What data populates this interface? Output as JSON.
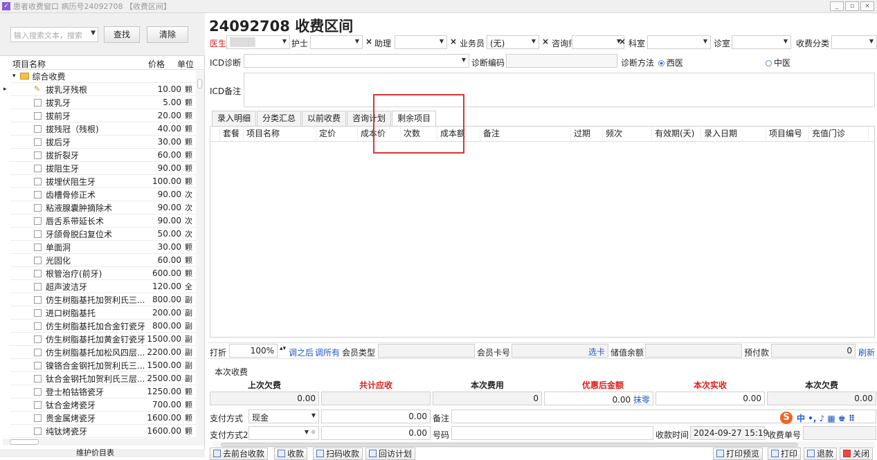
{
  "window": {
    "title": "患者收费窗口 病历号24092708 【收费区间】",
    "buttons": [
      "_",
      "▫",
      "×"
    ]
  },
  "left": {
    "search_placeholder": "输入搜索文本，搜索",
    "find_label": "查找",
    "clear_label": "清除",
    "columns": [
      "项目名称",
      "价格",
      "单位"
    ],
    "group": "综合收费",
    "items": [
      {
        "name": "拔乳牙残根",
        "price": "10.00",
        "unit": "颗"
      },
      {
        "name": "拔乳牙",
        "price": "5.00",
        "unit": "颗"
      },
      {
        "name": "拔前牙",
        "price": "20.00",
        "unit": "颗"
      },
      {
        "name": "拔残冠（残根)",
        "price": "40.00",
        "unit": "颗"
      },
      {
        "name": "拔后牙",
        "price": "30.00",
        "unit": "颗"
      },
      {
        "name": "拔折裂牙",
        "price": "60.00",
        "unit": "颗"
      },
      {
        "name": "拔阻生牙",
        "price": "90.00",
        "unit": "颗"
      },
      {
        "name": "拔埋伏阻生牙",
        "price": "100.00",
        "unit": "颗"
      },
      {
        "name": "齿槽骨修正术",
        "price": "90.00",
        "unit": "次"
      },
      {
        "name": "粘液腺囊肿摘除术",
        "price": "90.00",
        "unit": "次"
      },
      {
        "name": "唇舌系带延长术",
        "price": "90.00",
        "unit": "次"
      },
      {
        "name": "牙颌骨脱臼复位术",
        "price": "50.00",
        "unit": "次"
      },
      {
        "name": "单面洞",
        "price": "30.00",
        "unit": "颗"
      },
      {
        "name": "光固化",
        "price": "60.00",
        "unit": "颗"
      },
      {
        "name": "根管治疗(前牙)",
        "price": "600.00",
        "unit": "颗"
      },
      {
        "name": "超声波洁牙",
        "price": "120.00",
        "unit": "全"
      },
      {
        "name": "仿生树脂基托加贺利氏三...",
        "price": "800.00",
        "unit": "副"
      },
      {
        "name": "进口树脂基托",
        "price": "200.00",
        "unit": "副"
      },
      {
        "name": "仿生树脂基托加合金钉瓷牙",
        "price": "800.00",
        "unit": "副"
      },
      {
        "name": "仿生树脂基托加黄金钉瓷牙",
        "price": "1500.00",
        "unit": "副"
      },
      {
        "name": "仿生树脂基托加松风四层...",
        "price": "2200.00",
        "unit": "副"
      },
      {
        "name": "镍铬合金钢托加贺利氏三...",
        "price": "1500.00",
        "unit": "副"
      },
      {
        "name": "钛合金钢托加贺利氏三层...",
        "price": "2500.00",
        "unit": "副"
      },
      {
        "name": "登士柏钴铬瓷牙",
        "price": "1250.00",
        "unit": "颗"
      },
      {
        "name": "钛合金烤瓷牙",
        "price": "700.00",
        "unit": "颗"
      },
      {
        "name": "贵金属烤瓷牙",
        "price": "1600.00",
        "unit": "颗"
      },
      {
        "name": "纯钛烤瓷牙",
        "price": "1600.00",
        "unit": "颗"
      }
    ],
    "bottom_label": "维护价目表"
  },
  "header": {
    "title": "24092708 收费区间",
    "doctor_label": "医生",
    "nurse_label": "护士",
    "assistant_label": "助理",
    "salesman_label": "业务员",
    "salesman_value": "(无)",
    "consultant_label": "咨询师",
    "dept_label": "科室",
    "room_label": "诊室",
    "category_label": "收费分类",
    "icd_label": "ICD诊断",
    "icd_code_label": "诊断编码",
    "method_label": "诊断方法",
    "method_western": "西医",
    "method_chinese": "中医",
    "icd_note_label": "ICD备注"
  },
  "tabs": [
    "录入明细",
    "分类汇总",
    "以前收费",
    "咨询计划",
    "剩余项目"
  ],
  "grid_columns": [
    "套餐",
    "项目名称",
    "定价",
    "成本价",
    "次数",
    "成本额",
    "备注",
    "过期",
    "频次",
    "有效期(天)",
    "录入日期",
    "项目编号",
    "充值门诊"
  ],
  "discount": {
    "label": "打折",
    "value": "100%",
    "adjust_after": "调之后",
    "adjust_all": "调所有",
    "member_type_label": "会员类型",
    "member_card_label": "会员卡号",
    "select_card": "选卡",
    "balance_label": "储值余额",
    "prepay_label": "预付款",
    "prepay_value": "0",
    "refresh": "刷新"
  },
  "payment": {
    "section_label": "本次收费",
    "headers": [
      "上次欠费",
      "共计应收",
      "本次费用",
      "优惠后金额",
      "本次实收",
      "本次欠费"
    ],
    "header_colors": [
      "#222222",
      "#e01c1c",
      "#222222",
      "#e01c1c",
      "#e01c1c",
      "#222222"
    ],
    "last_owed": "0.00",
    "cost": "0",
    "discounted": "0.00",
    "round": "抹零",
    "received": "0.00",
    "owed": "0.00",
    "method1_label": "支付方式",
    "method1_value": "现金",
    "method1_amount": "0.00",
    "note_label": "备注",
    "method2_label": "支付方式2",
    "method2_amount": "0.00",
    "number_label": "号码",
    "time_label": "收款时间",
    "time_value": "2024-09-27 15:19",
    "receipt_label": "收费单号"
  },
  "ime": {
    "logo": "S",
    "text": "中 •, ♪ ▦ ♚ ⠿"
  },
  "toolbar": {
    "left": [
      "去前台收款",
      "收款",
      "扫码收款",
      "回访计划"
    ],
    "right": [
      "打印预览",
      "打印",
      "退款",
      "关闭"
    ]
  }
}
